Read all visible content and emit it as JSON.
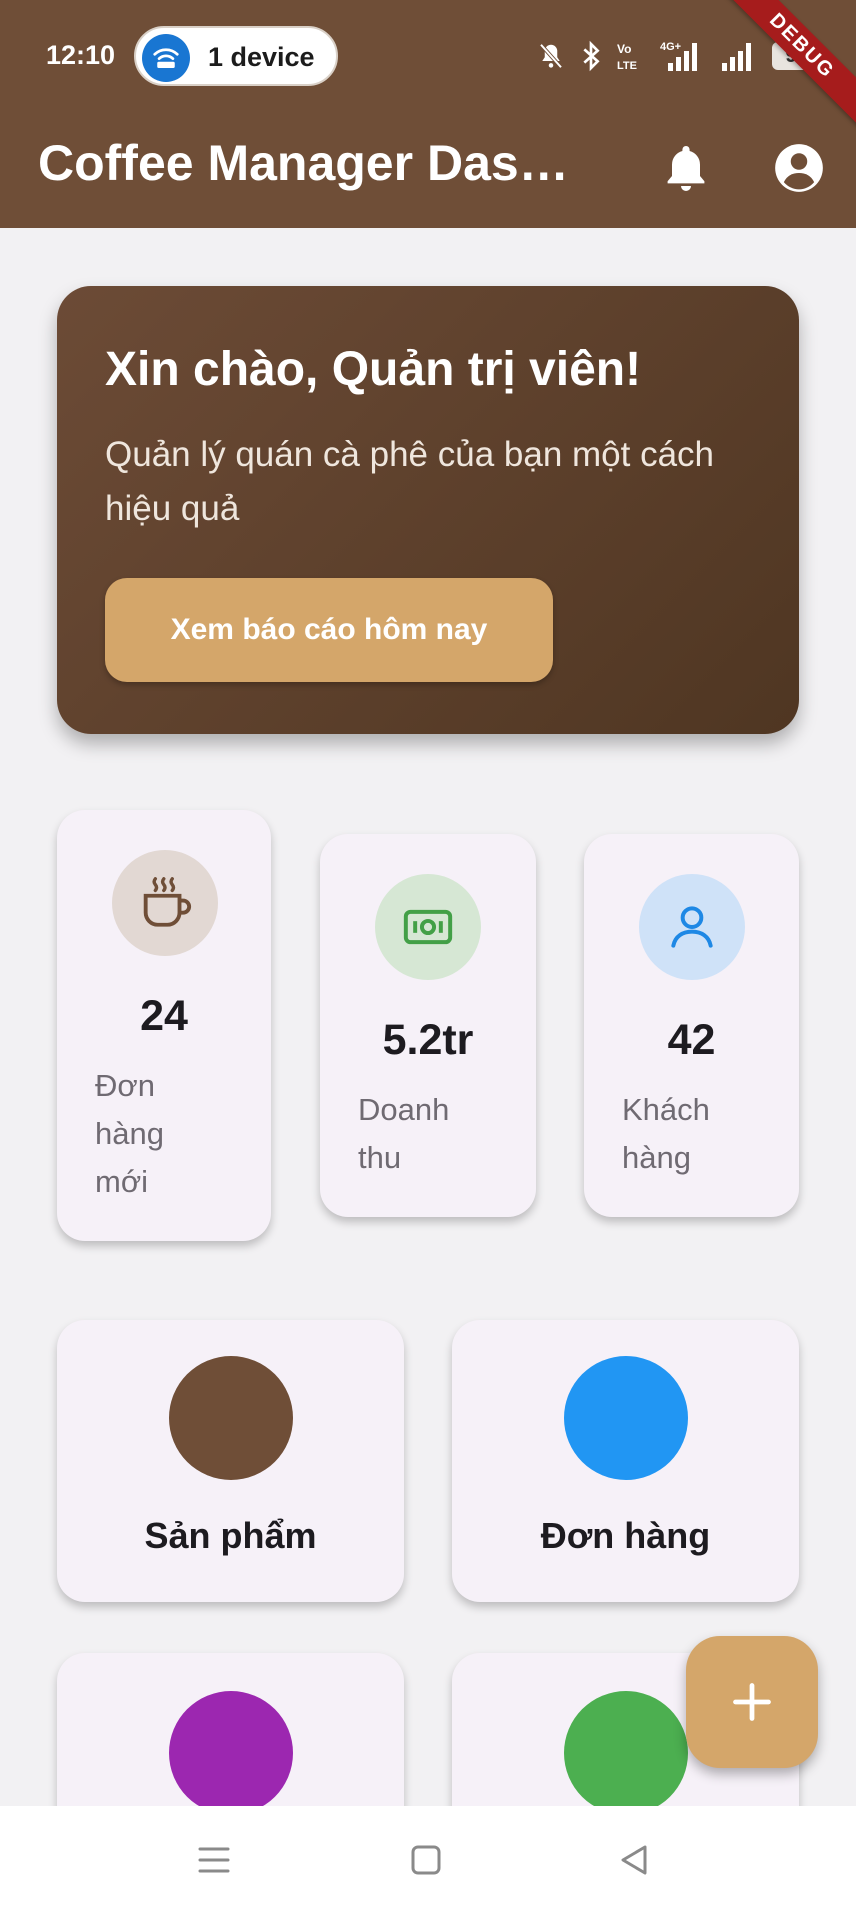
{
  "status_bar": {
    "time": "12:10",
    "device_pill": "1 device",
    "lte_label": "Vo LTE",
    "net_label": "4G+",
    "battery": "96",
    "debug_banner": "DEBUG"
  },
  "app_bar": {
    "title": "Coffee Manager Dashboard",
    "icons": [
      "bell-icon",
      "account-circle-icon"
    ]
  },
  "welcome": {
    "title": "Xin chào, Quản trị viên!",
    "subtitle": "Quản lý quán cà phê của bạn một cách hiệu quả",
    "button": "Xem báo cáo hôm nay"
  },
  "stats": [
    {
      "value": "24",
      "label": "Đơn hàng mới",
      "icon": "coffee-cup-icon",
      "circle_color": "#e2d8d3",
      "icon_color": "#6f4e37"
    },
    {
      "value": "5.2tr",
      "label": "Doanh thu",
      "icon": "money-icon",
      "circle_color": "#d6e7d4",
      "icon_color": "#43a047"
    },
    {
      "value": "42",
      "label": "Khách hàng",
      "icon": "person-icon",
      "circle_color": "#cfe2f8",
      "icon_color": "#1e88e5"
    }
  ],
  "menu": [
    {
      "label": "Sản phẩm",
      "color": "#6f4e37"
    },
    {
      "label": "Đơn hàng",
      "color": "#2196f3"
    },
    {
      "label": "",
      "color": "#9c27b0"
    },
    {
      "label": "",
      "color": "#4caf50"
    }
  ],
  "fab": {
    "icon": "plus-icon"
  },
  "colors": {
    "brand": "#6f4e37",
    "accent": "#d4a66a",
    "background": "#f2f1f3"
  }
}
